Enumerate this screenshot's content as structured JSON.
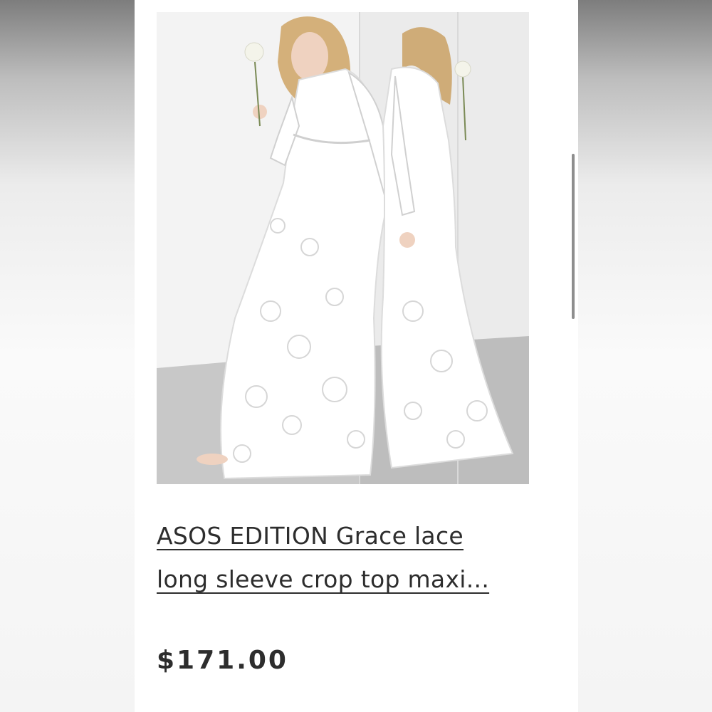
{
  "product": {
    "image_alt": "Model wearing white lace long sleeve crop top maxi dress, reflected in a mirror",
    "title_line1": "ASOS EDITION Grace lace",
    "title_line2": "long sleeve crop top maxi...",
    "price": "$171.00"
  },
  "colors": {
    "text": "#2d2d2d",
    "panel": "#ffffff",
    "scrollbar": "#8e8e8e"
  }
}
